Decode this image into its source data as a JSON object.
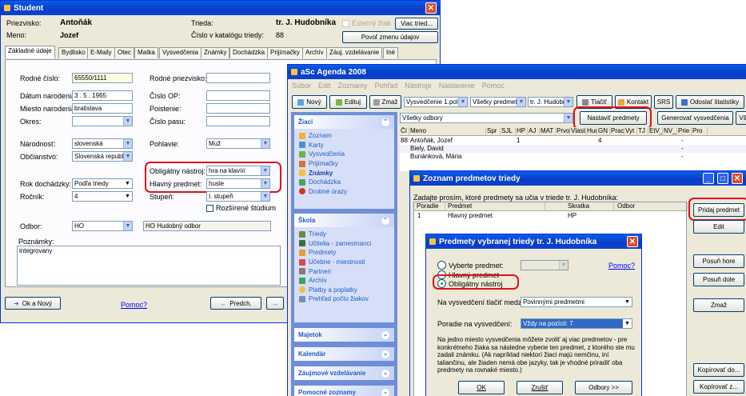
{
  "student": {
    "title": "Študent",
    "priezvisko_label": "Priezvisko:",
    "priezvisko": "Antoňák",
    "meno_label": "Meno:",
    "meno": "Jozef",
    "trieda_label": "Trieda:",
    "trieda": "tr. J. Hudobníka",
    "externy": "Externý žiak",
    "viac_tried": "Viac tried...",
    "cislo_label": "Číslo v katalógu triedy:",
    "cislo": "88",
    "povol": "Povoľ zmenu údajov",
    "tabs": [
      "Základné údaje",
      "Bydlisko",
      "E-Maily",
      "Otec",
      "Matka",
      "Vysvedčenia",
      "Známky",
      "Dochádzka",
      "Prijímačky",
      "Archív",
      "Záuj. vzdelávanie",
      "Iné"
    ],
    "rodne_cislo_label": "Rodné číslo:",
    "rodne_cislo": "65550/1111",
    "rodne_priezvisko_label": "Rodné priezvisko:",
    "datum_label": "Dátum narodenia:",
    "datum": "3 . 5 . 1965",
    "cislo_op_label": "Číslo OP:",
    "miesto_label": "Miesto narodenia:",
    "miesto": "bratislava",
    "poistenie_label": "Poistenie:",
    "okres_label": "Okres:",
    "cislo_pasu_label": "Číslo pasu:",
    "narodnost_label": "Národnosť:",
    "narodnost": "slovenská",
    "pohlavie_label": "Pohlavie:",
    "pohlavie": "Muž",
    "obcianstvo_label": "Občianstvo:",
    "obcianstvo": "Slovenská republ",
    "obligatny_label": "Obligátny nástroj:",
    "obligatny": "hra na klavíri",
    "rok_label": "Rok dochádzky:",
    "rok": "Podľa triedy",
    "hlavny_label": "Hlavný predmet:",
    "hlavny": "husle",
    "rocnik_label": "Ročník:",
    "rocnik": "4",
    "stupen_label": "Stupeň:",
    "stupen": "I. stupeň",
    "rozsirene": "Rozšírené štúdium",
    "odbor_label": "Odbor:",
    "odbor": "HO",
    "odbor_full": "HO Hudobný odbor",
    "poznamky_label": "Poznámky:",
    "poznamky": "integrovany",
    "ok_novy": "Ok a Nový",
    "pomoc": "Pomoc?",
    "predch": "Predch."
  },
  "agenda": {
    "title": "aSc Agenda 2008",
    "menu": [
      "Súbor",
      "Edit",
      "Zoznamy",
      "Pohľad",
      "Nástroje",
      "Nastavenie",
      "Pomoc"
    ],
    "toolbar": [
      "Nový",
      "Edituj",
      "Zmaž"
    ],
    "filters": [
      "Vysvedčenie 1.polrok",
      "Všetky predmety",
      "tr. J. Hudobník"
    ],
    "tlacit": "Tlačiť",
    "kontakt": "Kontakt",
    "srs": "SRS",
    "odoslat": "Odoslať štatistiky",
    "odbory": "Všetky odbory",
    "nastavit": "Nastaviť predmety",
    "generovat": "Generovať vysvedčenia",
    "vs": "Vš",
    "columns": [
      "Čí",
      "Meno",
      "Spr",
      "SJL",
      "HP",
      "AJ",
      "MAT",
      "Prvo",
      "Vlast",
      "Hud",
      "GN",
      "Prac",
      "Vyt",
      "TJ",
      "EtV_",
      "NV_",
      "Prie",
      "Pro"
    ],
    "rows": [
      {
        "num": "88",
        "name": "Antoňák, Jozef",
        "hp": "1",
        "gn": "4",
        "prie": "-"
      },
      {
        "num": "",
        "name": "Biely, David",
        "prie": "-"
      },
      {
        "num": "",
        "name": "Buriánková, Mária",
        "prie": "-"
      }
    ],
    "sidebar": {
      "ziaci": "Žiaci",
      "ziaci_items": [
        "Zoznam",
        "Karty",
        "Vysvedčenia",
        "Prijímačky",
        "Známky",
        "Dochádzka",
        "Drobné úrazy"
      ],
      "skola": "Škola",
      "skola_items": [
        "Triedy",
        "Učitelia - zamestnanci",
        "Predmety",
        "Učebne - miestnosti",
        "Partneri",
        "Archív",
        "Platby a poplatky",
        "Prehľad počtu žiakov"
      ],
      "majetok": "Majetok",
      "kalendar": "Kalendár",
      "zaujmove": "Záujmové vzdelávanie",
      "pomocne": "Pomocné zoznamy"
    }
  },
  "zoznam": {
    "title": "Zoznam predmetov triedy",
    "prompt": "Zadajte prosím, ktoré predmety sa učia v triede tr. J. Hudobníka:",
    "columns": [
      "Poradie",
      "Predmet",
      "Skratka",
      "Odbor"
    ],
    "rows": [
      {
        "poradie": "1",
        "predmet": "Hlavný predmet",
        "skratka": "HP",
        "odbor": ""
      }
    ],
    "buttons": [
      "Pridaj predmet",
      "Edit",
      "Posuň hore",
      "Posuň dole",
      "Zmaž",
      "Kopírovať do...",
      "Kopírovať z..."
    ]
  },
  "predmety": {
    "title": "Predmety vybranej triedy tr. J. Hudobníka",
    "vyberte": "Vyberte predmet:",
    "pomoc": "Pomoc?",
    "hlavny": "Hlavný predmet",
    "obligatny": "Obligátny nástroj",
    "tlacit_label": "Na vysvedčení tlačiť medzi:",
    "tlacit": "Povinnými predmetmi",
    "poradie_label": "Poradie na vysvedčení:",
    "poradie": "Vždy na pozícii: 7",
    "info": "Na jedno miesto vysvedčenia môžete zvoliť aj viac predmetov - pre konkrétneho žiaka sa následne vyberie ten predmet, z ktorého ste mu zadali známku. (Ak napríklad niektorí žiaci majú nemčinu, iní taliančinu, ale žiaden nemá obe jazyky, tak je vhodné priradiť oba predmety na rovnaké miesto.)",
    "ok": "OK",
    "zrusit": "Zrušiť",
    "odbory": "Odbory >>"
  },
  "colors": {
    "titlebar": "#0a4fd8",
    "highlight": "#e0101a",
    "link": "#0000ff",
    "sidebar_text": "#215dc6"
  }
}
